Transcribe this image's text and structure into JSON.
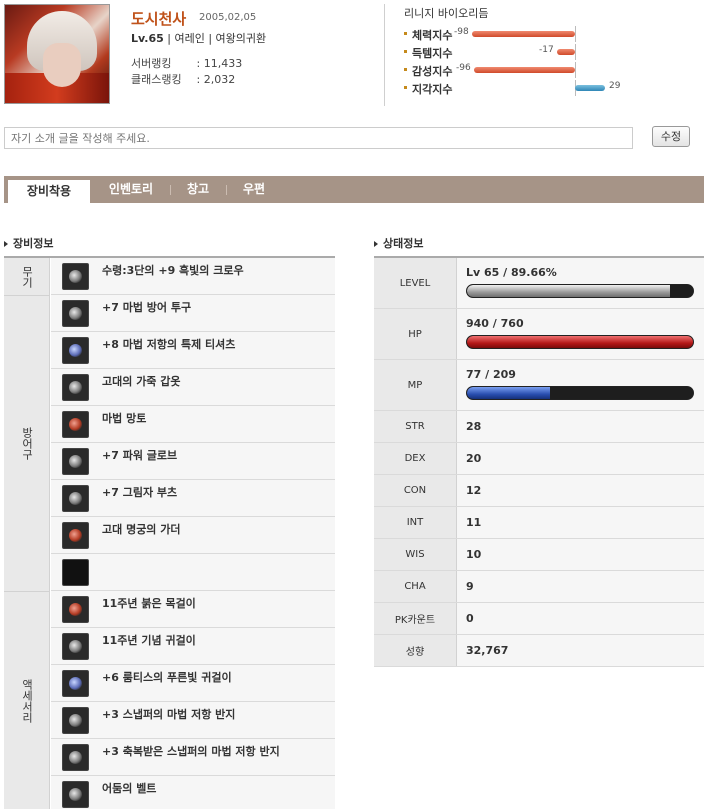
{
  "profile": {
    "name": "도시천사",
    "date": "2005,02,05",
    "level": "Lv.65",
    "class_info": " | 여레인 | 여왕의귀환",
    "ranks": [
      {
        "label": "서버랭킹",
        "value": ": 11,433"
      },
      {
        "label": "클래스랭킹",
        "value": ": 2,032"
      }
    ]
  },
  "biorhythm": {
    "title": "리니지 바이오리듬",
    "rows": [
      {
        "label": "체력지수",
        "value": -98,
        "value_text": "-98"
      },
      {
        "label": "득템지수",
        "value": -17,
        "value_text": "-17"
      },
      {
        "label": "감성지수",
        "value": -96,
        "value_text": "-96"
      },
      {
        "label": "지각지수",
        "value": 29,
        "value_text": "29"
      }
    ],
    "colors": {
      "negative": "#d04a2a",
      "positive": "#2f86b6"
    }
  },
  "intro": {
    "placeholder": "자기 소개 글을 작성해 주세요.",
    "edit_label": "수정"
  },
  "tabs": [
    {
      "label": "장비착용",
      "active": true
    },
    {
      "label": "인벤토리",
      "active": false
    },
    {
      "label": "창고",
      "active": false
    },
    {
      "label": "우편",
      "active": false
    }
  ],
  "equipment": {
    "title": "장비정보",
    "categories": [
      {
        "label": "무기"
      },
      {
        "label": "방어구"
      },
      {
        "label": "액세서리"
      }
    ],
    "items": [
      {
        "name": "수령:3단의 +9 흑빛의 크로우",
        "icon": "claw-weapon-icon"
      },
      {
        "name": "+7 마법 방어 투구",
        "icon": "helmet-icon"
      },
      {
        "name": "+8 마법 저항의 특제 티셔츠",
        "icon": "tshirt-icon"
      },
      {
        "name": "고대의 가죽 갑옷",
        "icon": "leather-armor-icon"
      },
      {
        "name": "마법 망토",
        "icon": "cloak-icon"
      },
      {
        "name": "+7 파워 글로브",
        "icon": "glove-icon"
      },
      {
        "name": "+7 그림자 부츠",
        "icon": "boots-icon"
      },
      {
        "name": "고대 명궁의 가더",
        "icon": "guarder-icon"
      },
      {
        "name": "",
        "icon": "empty-slot-icon"
      },
      {
        "name": "11주년 붉은 목걸이",
        "icon": "necklace-icon"
      },
      {
        "name": "11주년 기념 귀걸이",
        "icon": "earring-icon"
      },
      {
        "name": "+6 룸티스의 푸른빛 귀걸이",
        "icon": "blue-earring-icon"
      },
      {
        "name": "+3 스냅퍼의 마법 저항 반지",
        "icon": "ring-icon"
      },
      {
        "name": "+3 축복받은 스냅퍼의 마법 저항 반지",
        "icon": "blessed-ring-icon"
      },
      {
        "name": "어둠의 벨트",
        "icon": "belt-icon"
      }
    ]
  },
  "status": {
    "title": "상태정보",
    "bars": [
      {
        "label": "LEVEL",
        "text": "Lv 65 / 89.66%",
        "fill": 0.8966,
        "color": "#9a9a9a"
      },
      {
        "label": "HP",
        "text": "940 / 760",
        "fill": 1.0,
        "color": "#b31818"
      },
      {
        "label": "MP",
        "text": "77 / 209",
        "fill": 0.368,
        "color": "#2a4fb0"
      }
    ],
    "stats": [
      {
        "label": "STR",
        "value": "28"
      },
      {
        "label": "DEX",
        "value": "20"
      },
      {
        "label": "CON",
        "value": "12"
      },
      {
        "label": "INT",
        "value": "11"
      },
      {
        "label": "WIS",
        "value": "10"
      },
      {
        "label": "CHA",
        "value": "9"
      },
      {
        "label": "PK카운트",
        "value": "0"
      },
      {
        "label": "성향",
        "value": "32,767"
      }
    ]
  }
}
